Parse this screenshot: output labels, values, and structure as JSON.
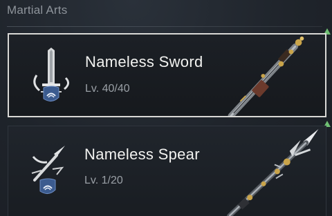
{
  "section": {
    "title": "Martial Arts"
  },
  "entries": [
    {
      "name": "Nameless Sword",
      "level": "Lv. 40/40",
      "icon": "sword-skill-icon",
      "weapon": "sword-art",
      "selected": true
    },
    {
      "name": "Nameless Spear",
      "level": "Lv. 1/20",
      "icon": "spear-skill-icon",
      "weapon": "spear-art",
      "selected": false
    }
  ],
  "colors": {
    "background": "#1f242b",
    "selected_border": "#d9d9d6",
    "badge_blue": "#3b5b8f",
    "upgrade_marker": "#6fbf73",
    "gold": "#c9a44a"
  }
}
